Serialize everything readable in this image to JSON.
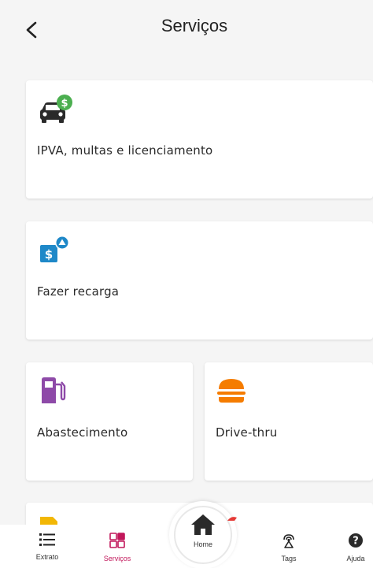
{
  "header": {
    "title": "Serviços",
    "back_icon": "chevron-left-icon"
  },
  "services": {
    "ipva": {
      "label": "IPVA, multas e licenciamento",
      "icon": "car-dollar-icon"
    },
    "recarga": {
      "label": "Fazer recarga",
      "icon": "recharge-dollar-icon"
    },
    "abastecimento": {
      "label": "Abastecimento",
      "icon": "fuel-pump-icon"
    },
    "drive_thru": {
      "label": "Drive-thru",
      "icon": "burger-icon"
    },
    "partial": {
      "icon": "document-icon"
    }
  },
  "bottom_nav": {
    "extrato": {
      "label": "Extrato",
      "icon": "list-icon"
    },
    "servicos": {
      "label": "Serviços",
      "icon": "grid-icon"
    },
    "home": {
      "label": "Home",
      "icon": "home-icon"
    },
    "tags": {
      "label": "Tags",
      "icon": "antenna-icon"
    },
    "ajuda": {
      "label": "Ajuda",
      "icon": "help-icon"
    }
  },
  "colors": {
    "accent": "#c2185b",
    "money_green": "#4caf50",
    "recharge_blue": "#1e88c8",
    "fuel_purple": "#8e4aa8",
    "burger_orange": "#f57c00",
    "doc_yellow": "#f2b705"
  }
}
